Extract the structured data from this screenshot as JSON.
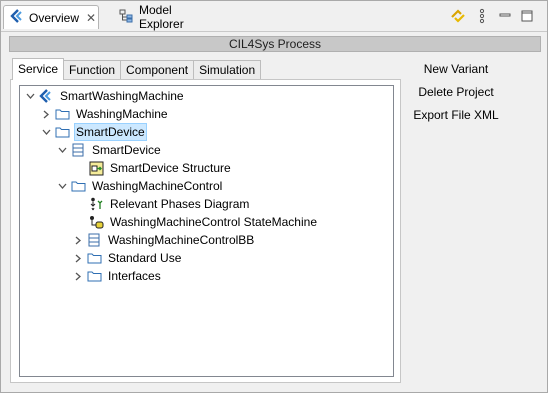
{
  "tabs_bar": {
    "overview_label": "Overview",
    "model_explorer_label": "Model Explorer"
  },
  "process_title": "CIL4Sys Process",
  "panel_tabs": [
    "Service",
    "Function",
    "Component",
    "Simulation"
  ],
  "tree": [
    {
      "label": "SmartWashingMachine",
      "icon": "capella-logo-icon"
    },
    {
      "label": "WashingMachine",
      "icon": "folder-icon"
    },
    {
      "label": "SmartDevice",
      "icon": "folder-icon"
    },
    {
      "label": "SmartDevice",
      "icon": "block-icon"
    },
    {
      "label": "SmartDevice Structure",
      "icon": "structure-diagram-icon"
    },
    {
      "label": "WashingMachineControl",
      "icon": "folder-icon"
    },
    {
      "label": "Relevant Phases Diagram",
      "icon": "phases-diagram-icon"
    },
    {
      "label": "WashingMachineControl StateMachine",
      "icon": "state-machine-icon"
    },
    {
      "label": "WashingMachineControlBB",
      "icon": "block-icon"
    },
    {
      "label": "Standard Use",
      "icon": "folder-icon"
    },
    {
      "label": "Interfaces",
      "icon": "folder-icon"
    }
  ],
  "actions": {
    "new_variant": "New Variant",
    "delete_project": "Delete Project",
    "export_xml": "Export File XML"
  },
  "colors": {
    "selection": "#cce8ff",
    "header_bar": "#c8c8c8",
    "folder": "#2f6fb3"
  }
}
